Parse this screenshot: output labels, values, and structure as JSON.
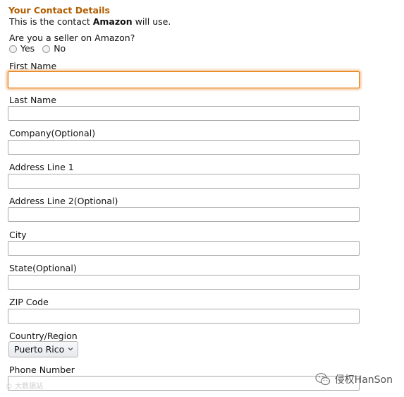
{
  "section": {
    "title": "Your Contact Details",
    "subtitle_prefix": "This is the contact ",
    "subtitle_brand": "Amazon",
    "subtitle_suffix": " will use."
  },
  "seller_question": {
    "label": "Are you a seller on Amazon?",
    "options": [
      "Yes",
      "No"
    ]
  },
  "fields": {
    "first_name": {
      "label": "First Name",
      "value": ""
    },
    "last_name": {
      "label": "Last Name",
      "value": ""
    },
    "company": {
      "label": "Company(Optional)",
      "value": ""
    },
    "address1": {
      "label": "Address Line 1",
      "value": ""
    },
    "address2": {
      "label": "Address Line 2(Optional)",
      "value": ""
    },
    "city": {
      "label": "City",
      "value": ""
    },
    "state": {
      "label": "State(Optional)",
      "value": ""
    },
    "zip": {
      "label": "ZIP Code",
      "value": ""
    },
    "country": {
      "label": "Country/Region",
      "selected": "Puerto Rico"
    },
    "phone": {
      "label": "Phone Number",
      "value": ""
    }
  },
  "watermarks": {
    "left": "© 大数据站",
    "right": "侵权HanSon"
  },
  "colors": {
    "title": "#b35e00",
    "focus": "#e77600"
  }
}
